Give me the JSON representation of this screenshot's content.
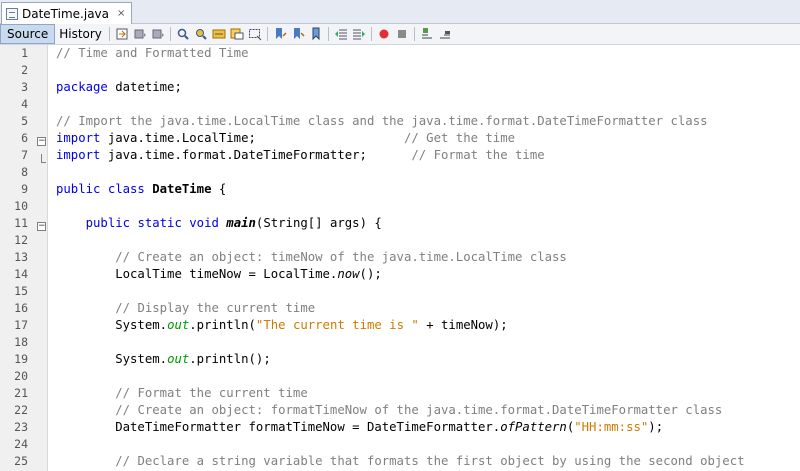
{
  "tab": {
    "title": "DateTime.java",
    "close": "×"
  },
  "toolbar": {
    "source_label": "Source",
    "history_label": "History"
  },
  "editor": {
    "line_numbers": [
      "1",
      "2",
      "3",
      "4",
      "5",
      "6",
      "7",
      "8",
      "9",
      "10",
      "11",
      "12",
      "13",
      "14",
      "15",
      "16",
      "17",
      "18",
      "19",
      "20",
      "21",
      "22",
      "23",
      "24",
      "25"
    ],
    "lines": [
      [
        {
          "t": "// Time and Formatted Time",
          "c": "cm"
        }
      ],
      [],
      [
        {
          "t": "package",
          "c": "kw"
        },
        {
          "t": " datetime;",
          "c": ""
        }
      ],
      [],
      [
        {
          "t": "// Import the java.time.LocalTime class and the java.time.format.DateTimeFormatter class",
          "c": "cm"
        }
      ],
      [
        {
          "t": "import",
          "c": "kw"
        },
        {
          "t": " java.time.LocalTime;                    ",
          "c": ""
        },
        {
          "t": "// Get the time",
          "c": "cm"
        }
      ],
      [
        {
          "t": "import",
          "c": "kw"
        },
        {
          "t": " java.time.format.DateTimeFormatter;      ",
          "c": ""
        },
        {
          "t": "// Format the time",
          "c": "cm"
        }
      ],
      [],
      [
        {
          "t": "public class",
          "c": "kw"
        },
        {
          "t": " ",
          "c": ""
        },
        {
          "t": "DateTime",
          "c": "bold"
        },
        {
          "t": " {",
          "c": ""
        }
      ],
      [],
      [
        {
          "t": "    ",
          "c": ""
        },
        {
          "t": "public static void",
          "c": "kw"
        },
        {
          "t": " ",
          "c": ""
        },
        {
          "t": "main",
          "c": "ib"
        },
        {
          "t": "(String[] args) {",
          "c": ""
        }
      ],
      [],
      [
        {
          "t": "        ",
          "c": ""
        },
        {
          "t": "// Create an object: timeNow of the java.time.LocalTime class",
          "c": "cm"
        }
      ],
      [
        {
          "t": "        LocalTime timeNow = LocalTime.",
          "c": ""
        },
        {
          "t": "now",
          "c": "ital"
        },
        {
          "t": "();",
          "c": ""
        }
      ],
      [],
      [
        {
          "t": "        ",
          "c": ""
        },
        {
          "t": "// Display the current time",
          "c": "cm"
        }
      ],
      [
        {
          "t": "        System.",
          "c": ""
        },
        {
          "t": "out",
          "c": "fld"
        },
        {
          "t": ".println(",
          "c": ""
        },
        {
          "t": "\"The current time is \"",
          "c": "st"
        },
        {
          "t": " + timeNow);",
          "c": ""
        }
      ],
      [],
      [
        {
          "t": "        System.",
          "c": ""
        },
        {
          "t": "out",
          "c": "fld"
        },
        {
          "t": ".println();",
          "c": ""
        }
      ],
      [],
      [
        {
          "t": "        ",
          "c": ""
        },
        {
          "t": "// Format the current time",
          "c": "cm"
        }
      ],
      [
        {
          "t": "        ",
          "c": ""
        },
        {
          "t": "// Create an object: formatTimeNow of the java.time.format.DateTimeFormatter class",
          "c": "cm"
        }
      ],
      [
        {
          "t": "        DateTimeFormatter formatTimeNow = DateTimeFormatter.",
          "c": ""
        },
        {
          "t": "ofPattern",
          "c": "ital"
        },
        {
          "t": "(",
          "c": ""
        },
        {
          "t": "\"HH:mm:ss\"",
          "c": "st"
        },
        {
          "t": ");",
          "c": ""
        }
      ],
      [],
      [
        {
          "t": "        ",
          "c": ""
        },
        {
          "t": "// Declare a string variable that formats the first object by using the second object",
          "c": "cm"
        }
      ]
    ]
  },
  "colors": {
    "keyword": "#0000e6",
    "comment": "#808080",
    "string": "#ce7b00",
    "field": "#009900"
  },
  "icons": [
    "last-edit-icon",
    "back-icon",
    "forward-icon",
    "find-prev-icon",
    "find-next-icon",
    "find-selection-icon",
    "toggle-highlight-icon",
    "toggle-rect-select-icon",
    "prev-bookmark-icon",
    "next-bookmark-icon",
    "toggle-bookmark-icon",
    "shift-left-icon",
    "shift-right-icon",
    "record-macro-icon",
    "stop-macro-icon",
    "comment-icon",
    "uncomment-icon"
  ]
}
